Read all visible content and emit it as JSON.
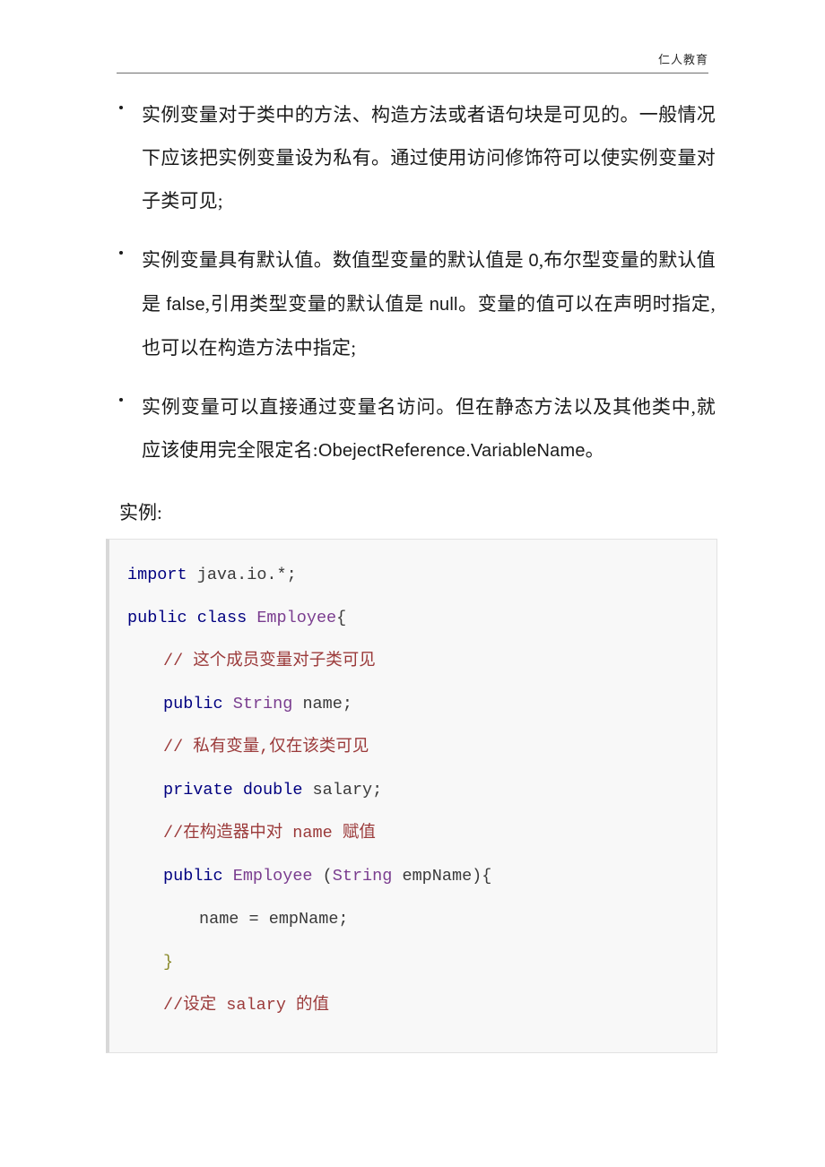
{
  "header": {
    "title": "仁人教育"
  },
  "bullets": [
    {
      "text": "实例变量对于类中的方法、构造方法或者语句块是可见的。一般情况下应该把实例变量设为私有。通过使用访问修饰符可以使实例变量对子类可见;"
    },
    {
      "prefix": "实例变量具有默认值。数值型变量的默认值是 ",
      "v1": "0",
      "mid1": ",布尔型变量的默认值是 ",
      "v2": "false",
      "mid2": ",引用类型变量的默认值是 ",
      "v3": "null",
      "suffix": "。变量的值可以在声明时指定,也可以在构造方法中指定;"
    },
    {
      "prefix": "实例变量可以直接通过变量名访问。但在静态方法以及其他类中,就应该使用完全限定名:",
      "code": "ObejectReference.VariableName",
      "suffix": "。"
    }
  ],
  "example_label": "实例:",
  "code_block": {
    "lines": [
      {
        "indent": 0,
        "tokens": [
          {
            "t": "import ",
            "c": "kw"
          },
          {
            "t": "java.io.*;",
            "c": "plain"
          }
        ]
      },
      {
        "indent": 0,
        "tokens": [
          {
            "t": "public class ",
            "c": "kw"
          },
          {
            "t": "Employee",
            "c": "type"
          },
          {
            "t": "{",
            "c": "punct"
          }
        ]
      },
      {
        "indent": 1,
        "tokens": [
          {
            "t": "// 这个成员变量对子类可见",
            "c": "comment"
          }
        ]
      },
      {
        "indent": 1,
        "tokens": [
          {
            "t": "public ",
            "c": "kw"
          },
          {
            "t": "String ",
            "c": "type"
          },
          {
            "t": "name;",
            "c": "plain"
          }
        ]
      },
      {
        "indent": 1,
        "tokens": [
          {
            "t": "// 私有变量,仅在该类可见",
            "c": "comment"
          }
        ]
      },
      {
        "indent": 1,
        "tokens": [
          {
            "t": "private double ",
            "c": "kw"
          },
          {
            "t": "salary;",
            "c": "plain"
          }
        ]
      },
      {
        "indent": 1,
        "tokens": [
          {
            "t": "//在构造器中对 name 赋值",
            "c": "comment"
          }
        ]
      },
      {
        "indent": 1,
        "tokens": [
          {
            "t": "public ",
            "c": "kw"
          },
          {
            "t": "Employee ",
            "c": "type"
          },
          {
            "t": "(",
            "c": "punct"
          },
          {
            "t": "String ",
            "c": "type"
          },
          {
            "t": "empName)",
            "c": "plain"
          },
          {
            "t": "{",
            "c": "punct"
          }
        ]
      },
      {
        "indent": 2,
        "tokens": [
          {
            "t": "name = empName;",
            "c": "plain"
          }
        ]
      },
      {
        "indent": 1,
        "tokens": [
          {
            "t": "}",
            "c": "brace"
          }
        ]
      },
      {
        "indent": 1,
        "tokens": [
          {
            "t": "//设定 salary 的值",
            "c": "comment"
          }
        ]
      }
    ]
  },
  "colors": {
    "keyword": "#000080",
    "type": "#7a3d8f",
    "comment": "#9b3a3a",
    "brace": "#8a8a2a",
    "plain": "#3a3a3a",
    "code_bg": "#f8f8f8",
    "code_border": "#e2e2e2",
    "header_rule": "#6f6f6f"
  }
}
